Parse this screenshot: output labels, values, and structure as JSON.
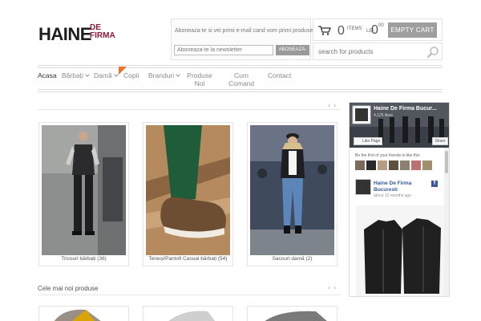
{
  "logo": {
    "main": "HAINE",
    "sub1": "DE",
    "sub2": "FIRMA"
  },
  "newsletter": {
    "text": "Aboneaza-te si vei primi e-mail cand vom primi produse noi !!!",
    "placeholder": "Aboneaza-te la newsletter",
    "button": "ABONEAZA-TE"
  },
  "cart": {
    "count": "0",
    "items_label": "ITEMS",
    "currency": "LEI",
    "total_int": "0",
    "total_dec": "00",
    "empty_label": "EMPTY CART"
  },
  "search": {
    "placeholder": "search for products"
  },
  "nav": {
    "items": [
      {
        "label": "Acasa"
      },
      {
        "label": "Bărbați"
      },
      {
        "label": "Damă"
      },
      {
        "label": "Copii"
      },
      {
        "label": "Branduri"
      },
      {
        "label": "Produse Noi"
      },
      {
        "label": "Cum Comand"
      },
      {
        "label": "Contact"
      }
    ]
  },
  "categories": [
    {
      "caption": "Tricouri bărbați (36)"
    },
    {
      "caption": "Teneși/Pantofi Casual bărbați (54)"
    },
    {
      "caption": "Sacouri damă (2)"
    }
  ],
  "new_products": {
    "title": "Cele mai noi produse"
  },
  "facebook": {
    "page_title": "Haine De Firma Bucur...",
    "likes": "4,125 likes",
    "like_button": "Like Page",
    "share_button": "Share",
    "friends_text": "Be the first of your friends to like this",
    "post_name_line1": "Haine De Firma",
    "post_name_line2": "Bucuresti",
    "post_time": "about 12 months ago"
  },
  "colors": {
    "accent": "#8a1a3a",
    "badge": "#e8742b",
    "button_gray": "#9e9e9e"
  }
}
